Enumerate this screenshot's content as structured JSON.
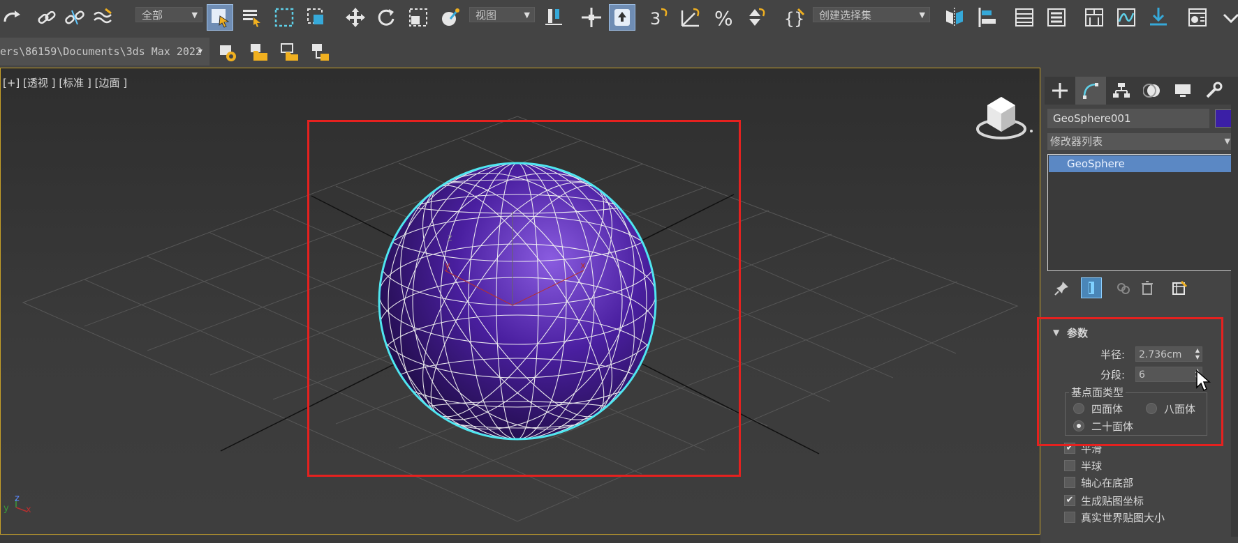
{
  "toolbar": {
    "selection_filter": "全部",
    "ref_coord": "视图",
    "named_selection": "创建选择集",
    "project_path": "ers\\86159\\Documents\\3ds Max 2022"
  },
  "viewport": {
    "label_plus": "[+]",
    "label_view": "[透视 ]",
    "label_shading": "[标准 ]",
    "label_display": "[边面 ]",
    "axis_x": "x",
    "axis_y": "y",
    "axis_z": "z",
    "gizmo_x": "x",
    "gizmo_y": "y",
    "gizmo_z": "z"
  },
  "command_panel": {
    "object_name": "GeoSphere001",
    "object_color": "#3b1fa6",
    "modifier_list": "修改器列表",
    "stack_item": "GeoSphere"
  },
  "parameters": {
    "title": "参数",
    "radius_label": "半径:",
    "radius_value": "2.736cm",
    "segments_label": "分段:",
    "segments_value": "6",
    "base_type_label": "基点面类型",
    "tetra": "四面体",
    "octa": "八面体",
    "icosa": "二十面体",
    "smooth": "平滑",
    "hemisphere": "半球",
    "base_pivot": "轴心在底部",
    "gen_map_coords": "生成贴图坐标",
    "real_world": "真实世界贴图大小"
  },
  "colors": {
    "accent_blue": "#5b88c4",
    "highlight_red": "#e5211f",
    "sphere_purple": "#4a1fa0",
    "selection_cyan": "#4fe6f0"
  }
}
